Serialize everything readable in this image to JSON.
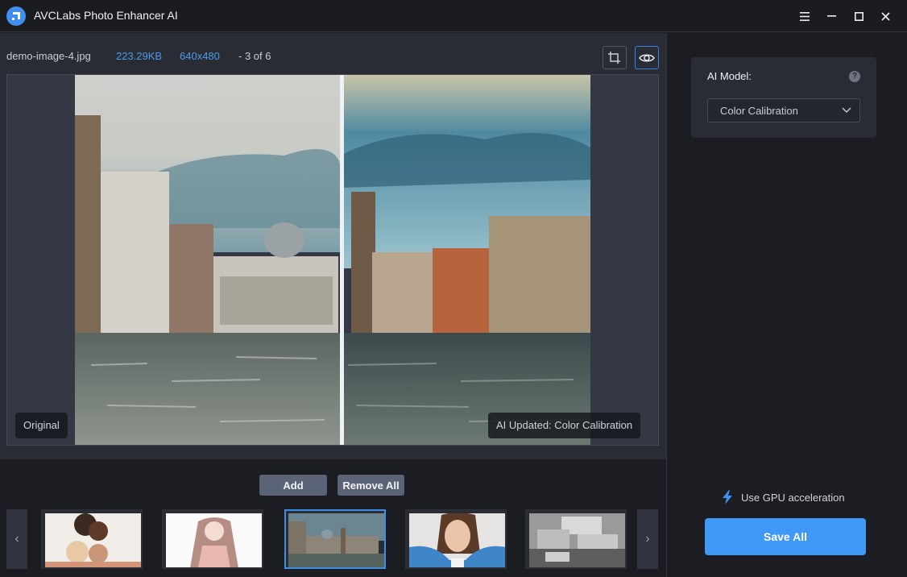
{
  "app": {
    "title": "AVCLabs Photo Enhancer AI"
  },
  "window_controls": [
    "menu-icon",
    "minimize-icon",
    "maximize-icon",
    "close-icon"
  ],
  "file_info": {
    "name": "demo-image-4.jpg",
    "size": "223.29KB",
    "dimensions": "640x480",
    "position": "- 3 of 6"
  },
  "toolbar": {
    "crop_icon": "crop-icon",
    "preview_icon": "eye-icon",
    "preview_active": true
  },
  "viewer": {
    "left_label": "Original",
    "right_label": "AI Updated: Color Calibration",
    "split_position": 0.51
  },
  "actions": {
    "add_label": "Add",
    "remove_all_label": "Remove All"
  },
  "thumbnails": {
    "prev_label": "‹",
    "next_label": "›",
    "items": [
      {
        "subject": "group selfie",
        "selected": false
      },
      {
        "subject": "anime girl",
        "selected": false
      },
      {
        "subject": "venice canal",
        "selected": true
      },
      {
        "subject": "woman hand gesture",
        "selected": false
      },
      {
        "subject": "grayscale town",
        "selected": false
      }
    ]
  },
  "settings": {
    "ai_model_label": "AI Model:",
    "help_glyph": "?",
    "ai_model_value": "Color Calibration",
    "gpu_label": "Use GPU acceleration",
    "save_label": "Save All"
  },
  "colors": {
    "accent": "#3f98f6",
    "info_blue": "#4c9be8",
    "selected_border": "#3e8ee6"
  }
}
